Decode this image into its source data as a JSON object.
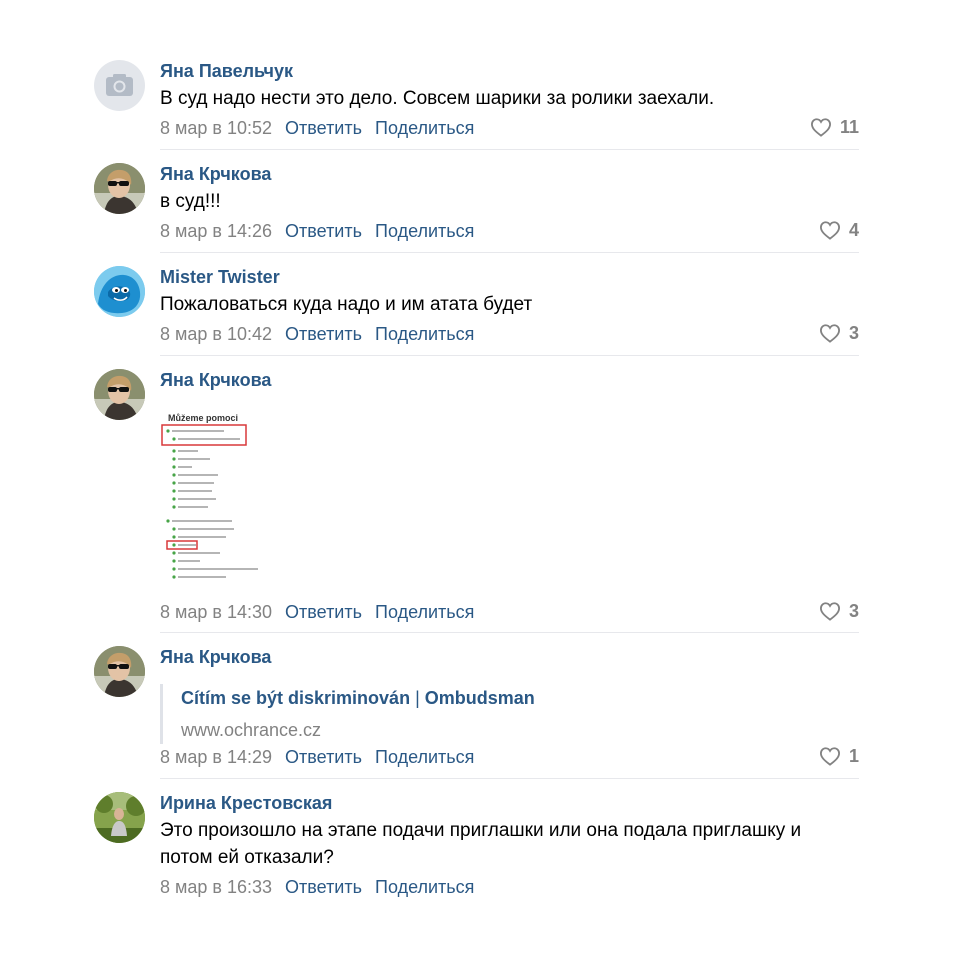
{
  "colors": {
    "link": "#2a5885",
    "meta": "#828282",
    "divider": "#e7e8ec"
  },
  "comments": [
    {
      "author": "Яна Павельчук",
      "text": "В суд надо нести это дело. Совсем шарики за ролики заехали.",
      "date": "8 мар в 10:52",
      "reply": "Ответить",
      "share": "Поделиться",
      "likes": "11",
      "avatar": "camera-placeholder-icon"
    },
    {
      "author": "Яна Крчкова",
      "text": "в суд!!!",
      "date": "8 мар в 14:26",
      "reply": "Ответить",
      "share": "Поделиться",
      "likes": "4",
      "avatar": "user-photo-sunglasses"
    },
    {
      "author": "Mister Twister",
      "text": "Пожаловаться куда надо и им атата будет",
      "date": "8 мар в 10:42",
      "reply": "Ответить",
      "share": "Поделиться",
      "likes": "3",
      "avatar": "blue-cartoon-avatar"
    },
    {
      "author": "Яна Крчкова",
      "attachment_heading": "Můžeme pomoci",
      "date": "8 мар в 14:30",
      "reply": "Ответить",
      "share": "Поделиться",
      "likes": "3",
      "avatar": "user-photo-sunglasses"
    },
    {
      "author": "Яна Крчкова",
      "link_title": "Cítím se být diskriminován",
      "link_sep": "|",
      "link_site": "Ombudsman",
      "link_url": "www.ochrance.cz",
      "date": "8 мар в 14:29",
      "reply": "Ответить",
      "share": "Поделиться",
      "likes": "1",
      "avatar": "user-photo-sunglasses"
    },
    {
      "author": "Ирина Крестовская",
      "text": "Это произошло на этапе подачи приглашки или она подала приглашку и потом ей отказали?",
      "date": "8 мар в 16:33",
      "reply": "Ответить",
      "share": "Поделиться",
      "avatar": "user-photo-outdoor"
    }
  ]
}
